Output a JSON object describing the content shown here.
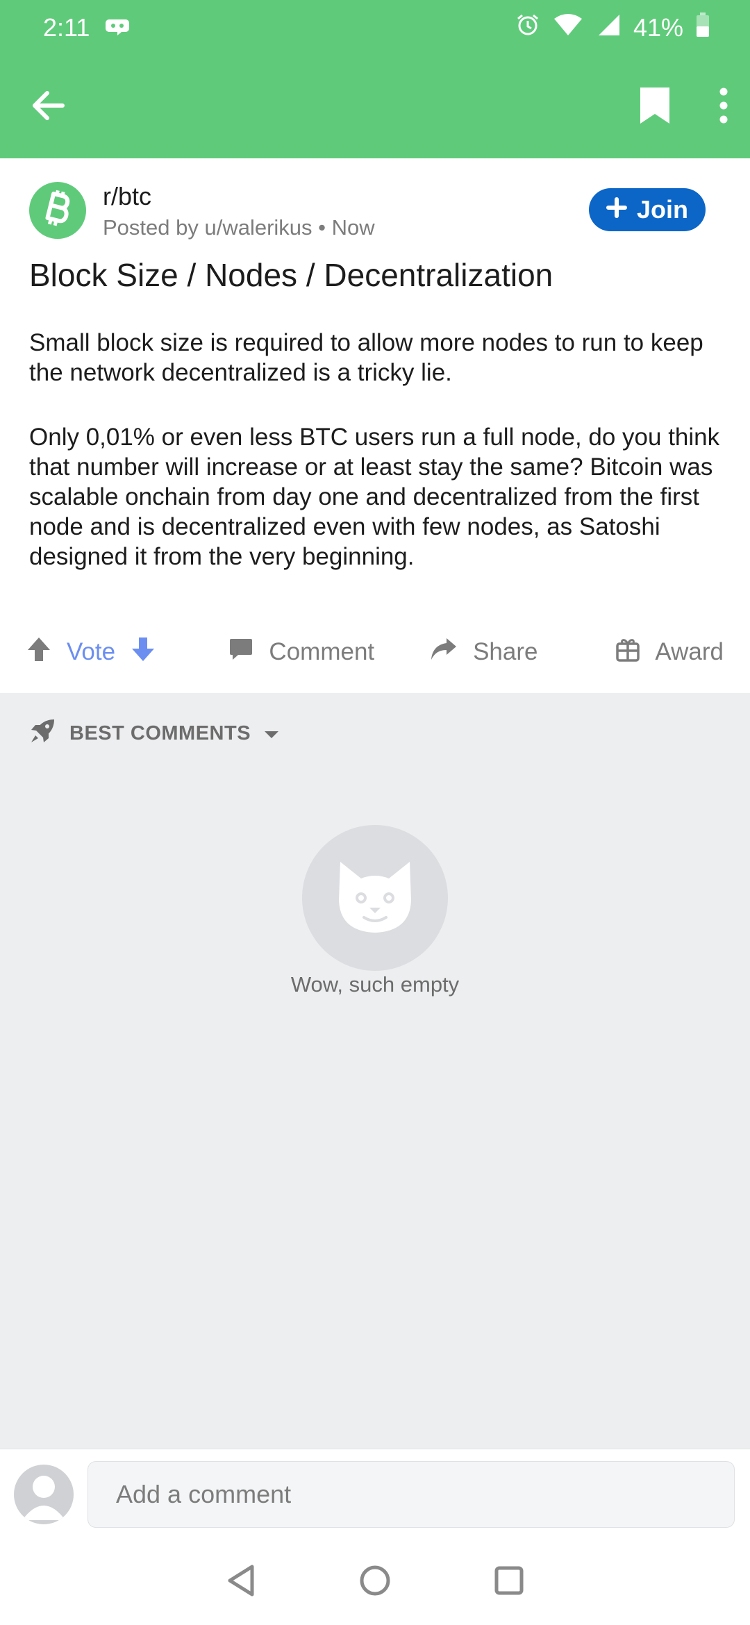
{
  "status_bar": {
    "time": "2:11",
    "battery": "41%"
  },
  "post": {
    "subreddit": "r/btc",
    "posted_by": "Posted by u/walerikus • Now",
    "join_label": "Join",
    "title": "Block Size / Nodes / Decentralization",
    "body": [
      "Small block size is required to allow more nodes to run to keep the network decentralized is a tricky lie.",
      "Only 0,01% or even less BTC users run a full node, do you think that number will increase or at least stay the same? Bitcoin was scalable onchain from day one and decentralized from the first node and is decentralized even with few nodes, as Satoshi designed it from the very beginning."
    ]
  },
  "actions": {
    "vote": "Vote",
    "comment": "Comment",
    "share": "Share",
    "award": "Award"
  },
  "comments": {
    "sort_label": "BEST COMMENTS",
    "empty_text": "Wow, such empty"
  },
  "composer": {
    "placeholder": "Add a comment"
  },
  "colors": {
    "brand_green": "#5fcb7a",
    "join_blue": "#0b66c8",
    "vote_blue": "#6b8ef0"
  }
}
